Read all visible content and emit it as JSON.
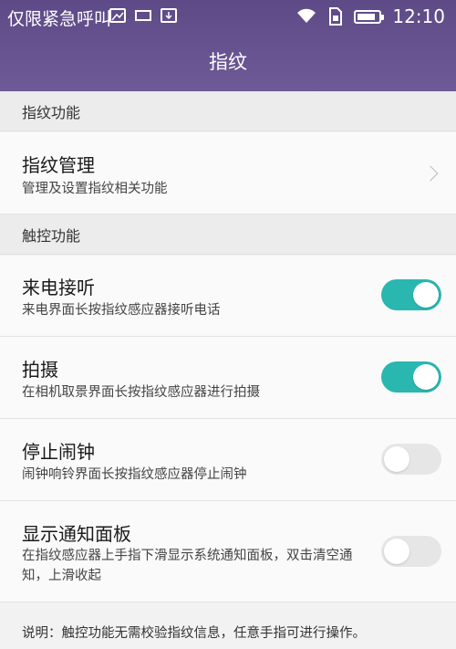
{
  "status_bar": {
    "carrier": "仅限紧急呼叫",
    "time": "12:10",
    "icons": [
      "image-icon",
      "keyboard-icon",
      "download-icon",
      "wifi-icon",
      "sim-icon",
      "battery-icon"
    ]
  },
  "header": {
    "title": "指纹"
  },
  "sections": {
    "fingerprint": "指纹功能",
    "touch": "触控功能"
  },
  "fingerprint_manage": {
    "title": "指纹管理",
    "subtitle": "管理及设置指纹相关功能"
  },
  "toggles": [
    {
      "title": "来电接听",
      "subtitle": "来电界面长按指纹感应器接听电话",
      "on": true
    },
    {
      "title": "拍摄",
      "subtitle": "在相机取景界面长按指纹感应器进行拍摄",
      "on": true
    },
    {
      "title": "停止闹钟",
      "subtitle": "闹钟响铃界面长按指纹感应器停止闹钟",
      "on": false
    },
    {
      "title": "显示通知面板",
      "subtitle": "在指纹感应器上手指下滑显示系统通知面板，双击清空通知，上滑收起",
      "on": false
    }
  ],
  "note": "说明：触控功能无需校验指纹信息，任意手指可进行操作。",
  "colors": {
    "header": "#6a5793",
    "toggle_on": "#2ab7b0",
    "toggle_off": "#e6e6e6"
  }
}
